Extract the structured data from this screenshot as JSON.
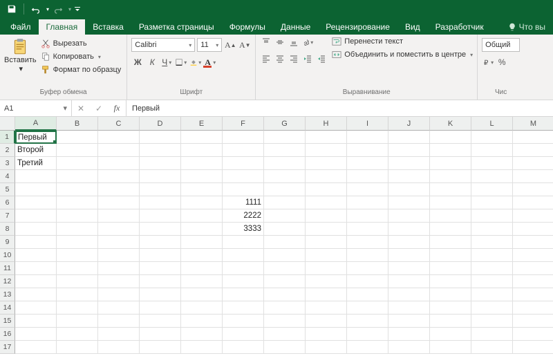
{
  "tabs": {
    "file": "Файл",
    "home": "Главная",
    "insert": "Вставка",
    "pagelayout": "Разметка страницы",
    "formulas": "Формулы",
    "data": "Данные",
    "review": "Рецензирование",
    "view": "Вид",
    "developer": "Разработчик",
    "tellme": "Что вы"
  },
  "ribbon": {
    "clipboard": {
      "paste": "Вставить",
      "cut": "Вырезать",
      "copy": "Копировать",
      "format_painter": "Формат по образцу",
      "label": "Буфер обмена"
    },
    "font": {
      "name": "Calibri",
      "size": "11",
      "label": "Шрифт",
      "bold": "Ж",
      "italic": "К",
      "underline": "Ч"
    },
    "alignment": {
      "wrap": "Перенести текст",
      "merge": "Объединить и поместить в центре",
      "label": "Выравнивание"
    },
    "number": {
      "format": "Общий",
      "label": "Чис"
    }
  },
  "formula_bar": {
    "name_box": "A1",
    "content": "Первый"
  },
  "columns": [
    "A",
    "B",
    "C",
    "D",
    "E",
    "F",
    "G",
    "H",
    "I",
    "J",
    "K",
    "L",
    "M"
  ],
  "rows": [
    "1",
    "2",
    "3",
    "4",
    "5",
    "6",
    "7",
    "8",
    "9",
    "10",
    "11",
    "12",
    "13",
    "14",
    "15",
    "16",
    "17"
  ],
  "cells": {
    "A1": "Первый",
    "A2": "Второй",
    "A3": "Третий",
    "F6": "1111",
    "F7": "2222",
    "F8": "3333"
  }
}
